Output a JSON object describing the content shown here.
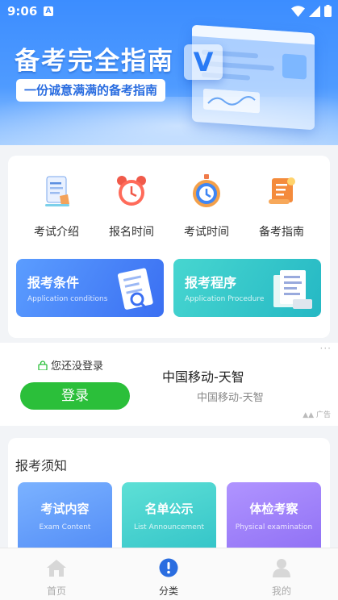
{
  "status": {
    "time": "9:06",
    "app_badge": "A"
  },
  "banner": {
    "title": "备考完全指南",
    "subtitle": "一份诚意满满的备考指南",
    "badge_letter": "V"
  },
  "menu": {
    "items": [
      {
        "label": "考试介绍",
        "icon": "document-icon"
      },
      {
        "label": "报名时间",
        "icon": "alarm-clock-icon"
      },
      {
        "label": "考试时间",
        "icon": "stopwatch-icon"
      },
      {
        "label": "备考指南",
        "icon": "scroll-icon"
      }
    ],
    "conditions": {
      "title": "报考条件",
      "subtitle": "Application conditions"
    },
    "procedure": {
      "title": "报考程序",
      "subtitle": "Application Procedure"
    }
  },
  "ad": {
    "login_hint": "您还没登录",
    "login_button": "登录",
    "brand": "中国移动-天智",
    "brand_sub": "中国移动-天智",
    "ad_tag": "广告"
  },
  "notice": {
    "title": "报考须知",
    "cards": [
      {
        "title": "考试内容",
        "subtitle": "Exam Content"
      },
      {
        "title": "名单公示",
        "subtitle": "List Announcement"
      },
      {
        "title": "体检考察",
        "subtitle": "Physical examination"
      }
    ]
  },
  "tabbar": {
    "tabs": [
      {
        "label": "首页",
        "icon": "home-icon",
        "active": false
      },
      {
        "label": "分类",
        "icon": "category-icon",
        "active": true
      },
      {
        "label": "我的",
        "icon": "profile-icon",
        "active": false
      }
    ]
  },
  "colors": {
    "primary_blue": "#3c8dff",
    "login_green": "#2bbf3a",
    "active_tab": "#2a6de0"
  }
}
